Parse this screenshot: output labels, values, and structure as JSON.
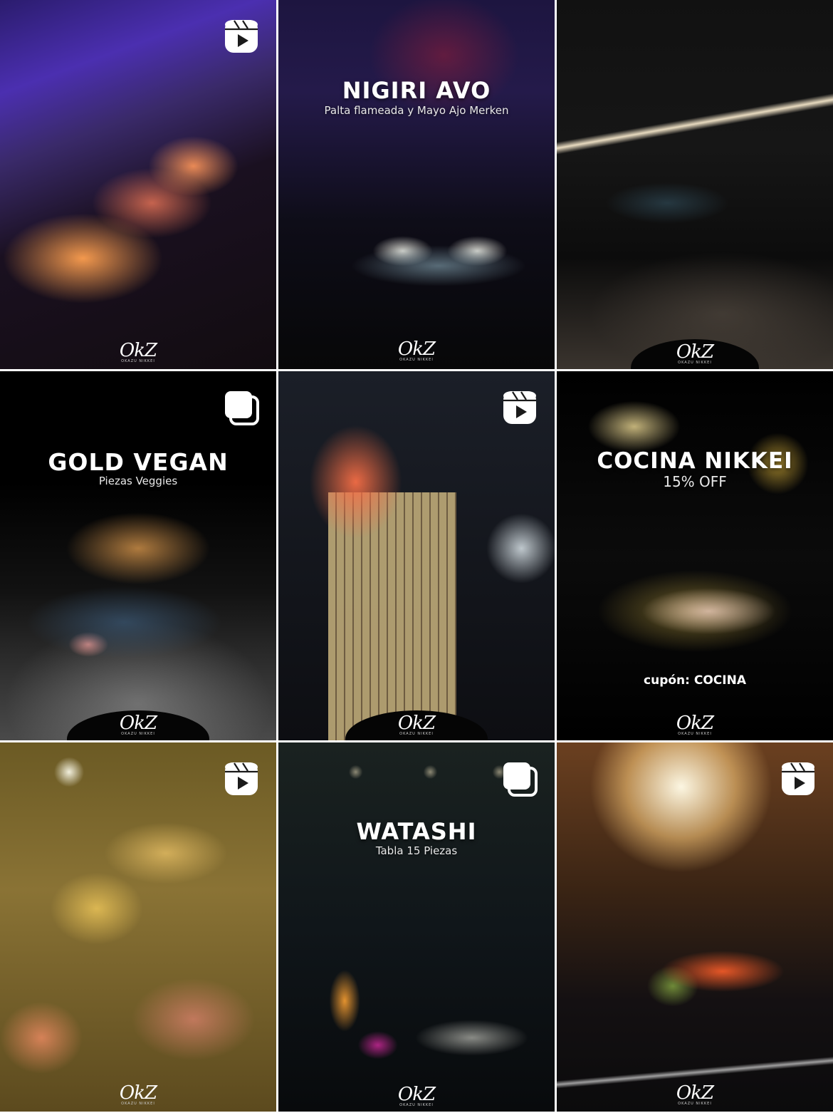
{
  "tiles": [
    {
      "id": "t1",
      "badge": "reel",
      "title": "",
      "subtitle": "",
      "coupon": ""
    },
    {
      "id": "t2",
      "badge": "",
      "title": "NIGIRI AVO",
      "subtitle": "Palta flameada y Mayo Ajo Merken",
      "coupon": ""
    },
    {
      "id": "t3",
      "badge": "",
      "title": "",
      "subtitle": "",
      "coupon": ""
    },
    {
      "id": "t4",
      "badge": "carousel",
      "title": "GOLD VEGAN",
      "subtitle": "Piezas Veggies",
      "coupon": ""
    },
    {
      "id": "t5",
      "badge": "reel",
      "title": "",
      "subtitle": "",
      "coupon": ""
    },
    {
      "id": "t6",
      "badge": "",
      "title": "COCINA NIKKEI",
      "subtitle": "15% OFF",
      "coupon": "cupón: COCINA"
    },
    {
      "id": "t7",
      "badge": "reel",
      "title": "",
      "subtitle": "",
      "coupon": ""
    },
    {
      "id": "t8",
      "badge": "carousel",
      "title": "WATASHI",
      "subtitle": "Tabla 15 Piezas",
      "coupon": ""
    },
    {
      "id": "t9",
      "badge": "reel",
      "title": "",
      "subtitle": "",
      "coupon": ""
    }
  ],
  "logo": {
    "mark": "OkZ",
    "caption": "OKAZU NIKKEI"
  },
  "icons": {
    "reel": "reel-icon",
    "carousel": "carousel-icon"
  }
}
